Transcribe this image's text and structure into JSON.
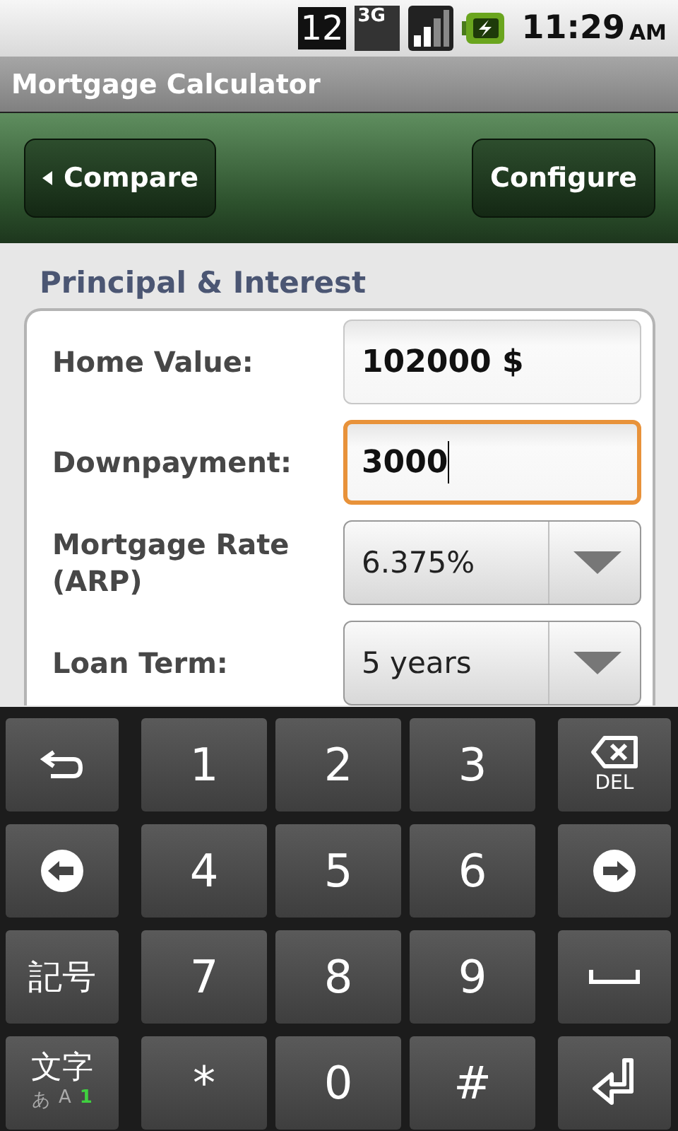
{
  "status_bar": {
    "notification": "12",
    "network": "3G",
    "time": "11:29",
    "meridiem": "AM"
  },
  "window": {
    "title": "Mortgage Calculator"
  },
  "toolbar": {
    "back_button": "Compare",
    "action_button": "Configure"
  },
  "section": {
    "title": "Principal & Interest",
    "fields": [
      {
        "kind": "input",
        "label": "Home Value:",
        "value": "102000 $",
        "focused": false
      },
      {
        "kind": "input",
        "label": "Downpayment:",
        "value": "3000",
        "focused": true
      },
      {
        "kind": "dropdown",
        "label": "Mortgage Rate (ARP)",
        "value": "6.375%"
      },
      {
        "kind": "dropdown",
        "label": "Loan Term:",
        "value": "5 years"
      }
    ]
  },
  "keyboard": {
    "rows": [
      [
        {
          "kind": "undo"
        },
        {
          "kind": "digit",
          "label": "1"
        },
        {
          "kind": "digit",
          "label": "2"
        },
        {
          "kind": "digit",
          "label": "3"
        },
        {
          "kind": "delete",
          "label": "DEL"
        }
      ],
      [
        {
          "kind": "left"
        },
        {
          "kind": "digit",
          "label": "4"
        },
        {
          "kind": "digit",
          "label": "5"
        },
        {
          "kind": "digit",
          "label": "6"
        },
        {
          "kind": "right"
        }
      ],
      [
        {
          "kind": "symbols",
          "label": "記号"
        },
        {
          "kind": "digit",
          "label": "7"
        },
        {
          "kind": "digit",
          "label": "8"
        },
        {
          "kind": "digit",
          "label": "9"
        },
        {
          "kind": "space"
        }
      ],
      [
        {
          "kind": "mode",
          "label": "文字",
          "modes": [
            {
              "label": "あ",
              "selected": false
            },
            {
              "label": "A",
              "selected": false
            },
            {
              "label": "1",
              "selected": true
            }
          ]
        },
        {
          "kind": "digit",
          "label": "*"
        },
        {
          "kind": "digit",
          "label": "0"
        },
        {
          "kind": "digit",
          "label": "#"
        },
        {
          "kind": "enter"
        }
      ]
    ]
  }
}
